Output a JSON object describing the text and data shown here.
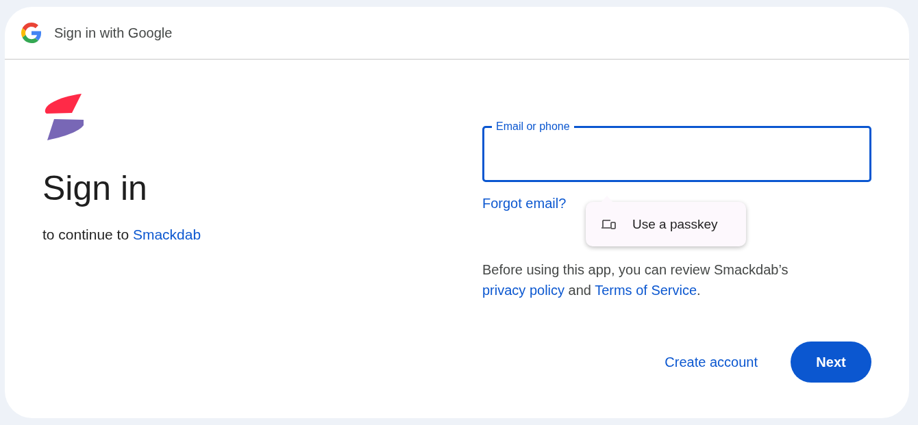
{
  "header": {
    "title": "Sign in with Google"
  },
  "left": {
    "heading": "Sign in",
    "subtitle": [
      {
        "kind": "text",
        "text": "to continue to "
      },
      {
        "kind": "link",
        "text": "Smackdab"
      }
    ]
  },
  "email_field": {
    "label": "Email or phone",
    "focused": true
  },
  "forgot_link": "Forgot email?",
  "passkey_popup": {
    "label": "Use a passkey"
  },
  "consent": [
    {
      "kind": "text",
      "text": "Before using this app, you can review Smackdab’s "
    },
    {
      "kind": "link",
      "text": "privacy policy"
    },
    {
      "kind": "text",
      "text": " and "
    },
    {
      "kind": "link",
      "text": "Terms of Service"
    },
    {
      "kind": "text",
      "text": "."
    }
  ],
  "actions": {
    "secondary": "Create account",
    "primary": "Next"
  }
}
